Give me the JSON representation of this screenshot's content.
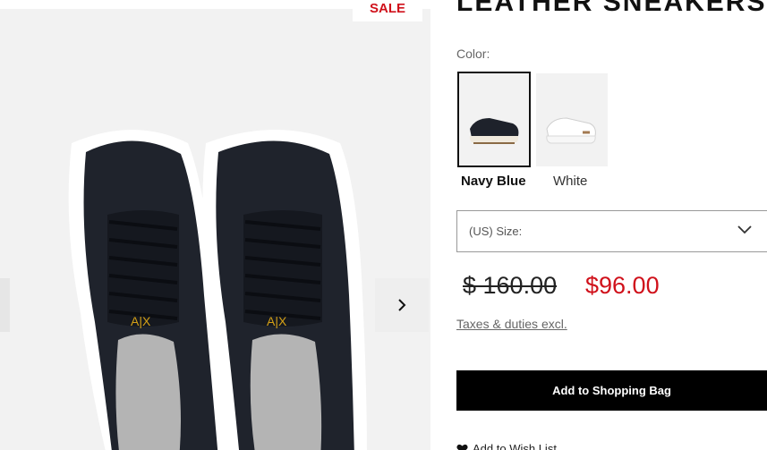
{
  "product": {
    "title": "LEATHER SNEAKERS",
    "sale_badge": "SALE"
  },
  "color": {
    "label": "Color:",
    "options": [
      {
        "name": "Navy Blue",
        "selected": true,
        "swatch": "#2a2f3a"
      },
      {
        "name": "White",
        "selected": false,
        "swatch": "#f4f4f4"
      }
    ]
  },
  "size": {
    "label": "(US) Size:"
  },
  "price": {
    "original": "$ 160.00",
    "sale": "$96.00",
    "sale_color": "#d0111b"
  },
  "links": {
    "taxes": "Taxes & duties excl."
  },
  "actions": {
    "add_to_bag": "Add to Shopping Bag",
    "wishlist": "Add to Wish List"
  },
  "icons": {
    "next": "chevron-right-icon",
    "dropdown": "chevron-down-icon",
    "wishlist": "heart-icon"
  }
}
